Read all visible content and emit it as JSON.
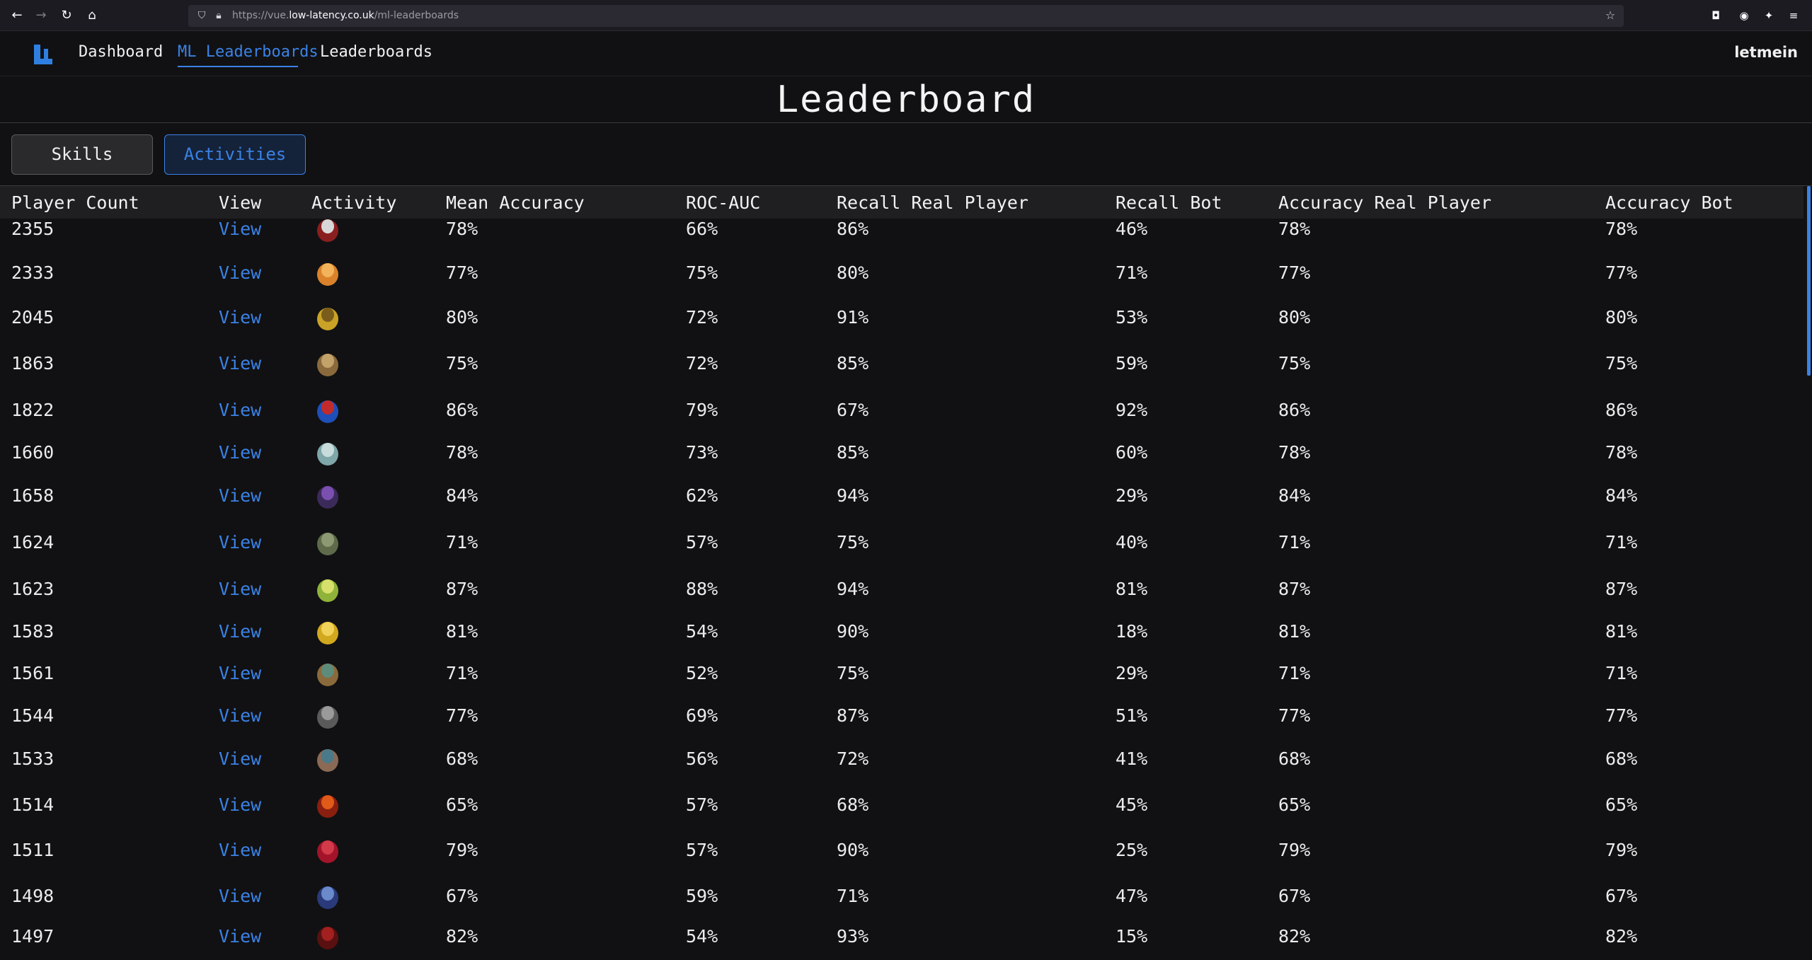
{
  "browser": {
    "url_prefix": "https://vue.",
    "url_host": "low-latency.co.uk",
    "url_path": "/ml-leaderboards"
  },
  "nav": {
    "links": [
      "Dashboard",
      "ML Leaderboards",
      "Leaderboards"
    ],
    "active": "ML Leaderboards",
    "user": "letmein"
  },
  "page": {
    "title": "Leaderboard",
    "toggles": [
      "Skills",
      "Activities"
    ],
    "selected_toggle": "Activities"
  },
  "table": {
    "headers": [
      "Player Count",
      "View",
      "Activity",
      "Mean Accuracy",
      "ROC-AUC",
      "Recall Real Player",
      "Recall Bot",
      "Accuracy Real Player",
      "Accuracy Bot"
    ],
    "rows": [
      {
        "count": "2355",
        "view": "View",
        "icon": "skull-emblem-icon",
        "mean": "78%",
        "roc": "66%",
        "recall_real": "86%",
        "recall_bot": "46%",
        "acc_real": "78%",
        "acc_bot": "78%"
      },
      {
        "count": "2333",
        "view": "View",
        "icon": "orange-dragon-icon",
        "mean": "77%",
        "roc": "75%",
        "recall_real": "80%",
        "recall_bot": "71%",
        "acc_real": "77%",
        "acc_bot": "77%"
      },
      {
        "count": "2045",
        "view": "View",
        "icon": "gold-axe-icon",
        "mean": "80%",
        "roc": "72%",
        "recall_real": "91%",
        "recall_bot": "53%",
        "acc_real": "80%",
        "acc_bot": "80%"
      },
      {
        "count": "1863",
        "view": "View",
        "icon": "robed-figure-icon",
        "mean": "75%",
        "roc": "72%",
        "recall_real": "85%",
        "recall_bot": "59%",
        "acc_real": "75%",
        "acc_bot": "75%"
      },
      {
        "count": "1822",
        "view": "View",
        "icon": "red-blue-shield-icon",
        "mean": "86%",
        "roc": "79%",
        "recall_real": "67%",
        "recall_bot": "92%",
        "acc_real": "86%",
        "acc_bot": "86%"
      },
      {
        "count": "1660",
        "view": "View",
        "icon": "ghost-blob-icon",
        "mean": "78%",
        "roc": "73%",
        "recall_real": "85%",
        "recall_bot": "60%",
        "acc_real": "78%",
        "acc_bot": "78%"
      },
      {
        "count": "1658",
        "view": "View",
        "icon": "purple-demon-icon",
        "mean": "84%",
        "roc": "62%",
        "recall_real": "94%",
        "recall_bot": "29%",
        "acc_real": "84%",
        "acc_bot": "84%"
      },
      {
        "count": "1624",
        "view": "View",
        "icon": "green-beast-icon",
        "mean": "71%",
        "roc": "57%",
        "recall_real": "75%",
        "recall_bot": "40%",
        "acc_real": "71%",
        "acc_bot": "71%"
      },
      {
        "count": "1623",
        "view": "View",
        "icon": "green-serpent-icon",
        "mean": "87%",
        "roc": "88%",
        "recall_real": "94%",
        "recall_bot": "81%",
        "acc_real": "87%",
        "acc_bot": "87%"
      },
      {
        "count": "1583",
        "view": "View",
        "icon": "golden-horned-icon",
        "mean": "81%",
        "roc": "54%",
        "recall_real": "90%",
        "recall_bot": "18%",
        "acc_real": "81%",
        "acc_bot": "81%"
      },
      {
        "count": "1561",
        "view": "View",
        "icon": "treasure-chest-icon",
        "mean": "71%",
        "roc": "52%",
        "recall_real": "75%",
        "recall_bot": "29%",
        "acc_real": "71%",
        "acc_bot": "71%"
      },
      {
        "count": "1544",
        "view": "View",
        "icon": "grey-bear-icon",
        "mean": "77%",
        "roc": "69%",
        "recall_real": "87%",
        "recall_bot": "51%",
        "acc_real": "77%",
        "acc_bot": "77%"
      },
      {
        "count": "1533",
        "view": "View",
        "icon": "standing-figure-icon",
        "mean": "68%",
        "roc": "56%",
        "recall_real": "72%",
        "recall_bot": "41%",
        "acc_real": "68%",
        "acc_bot": "68%"
      },
      {
        "count": "1514",
        "view": "View",
        "icon": "red-spider-icon",
        "mean": "65%",
        "roc": "57%",
        "recall_real": "68%",
        "recall_bot": "45%",
        "acc_real": "65%",
        "acc_bot": "65%"
      },
      {
        "count": "1511",
        "view": "View",
        "icon": "crimson-blob-icon",
        "mean": "79%",
        "roc": "57%",
        "recall_real": "90%",
        "recall_bot": "25%",
        "acc_real": "79%",
        "acc_bot": "79%"
      },
      {
        "count": "1498",
        "view": "View",
        "icon": "blue-totem-icon",
        "mean": "67%",
        "roc": "59%",
        "recall_real": "71%",
        "recall_bot": "47%",
        "acc_real": "67%",
        "acc_bot": "67%"
      },
      {
        "count": "1497",
        "view": "View",
        "icon": "dark-red-creature-icon",
        "mean": "82%",
        "roc": "54%",
        "recall_real": "93%",
        "recall_bot": "15%",
        "acc_real": "82%",
        "acc_bot": "82%"
      }
    ]
  },
  "colors": {
    "accent": "#3b82e6",
    "background": "#111113",
    "header_row": "#1f1f22"
  }
}
